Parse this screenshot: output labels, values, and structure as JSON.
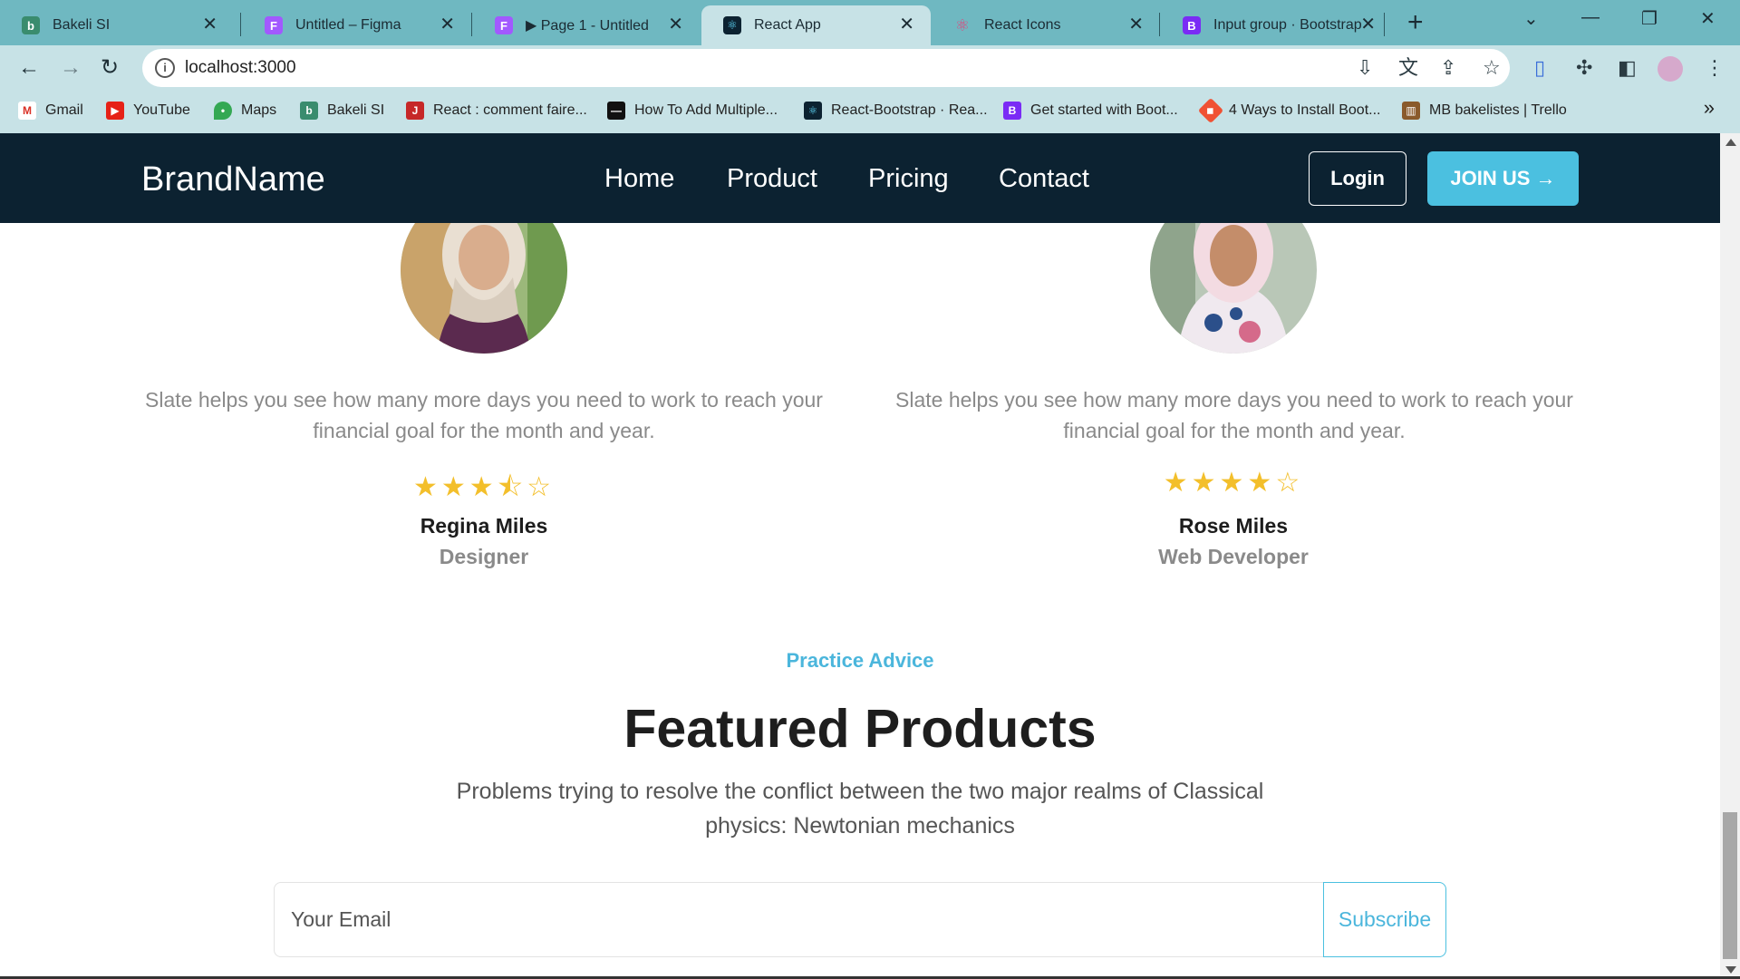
{
  "browser": {
    "tabs": [
      {
        "label": "Bakeli SI",
        "icon": "bakeli-icon",
        "color": "#3a8c6e"
      },
      {
        "label": "Untitled – Figma",
        "icon": "figma-icon",
        "color": "#a259ff"
      },
      {
        "label": "▶ Page 1 - Untitled",
        "icon": "figma-icon",
        "color": "#a259ff"
      },
      {
        "label": "React App",
        "icon": "react-icon",
        "color": "#0c2231"
      },
      {
        "label": "React Icons",
        "icon": "react-icon",
        "color": "#e0457b"
      },
      {
        "label": "Input group · Bootstrap",
        "icon": "bootstrap-icon",
        "color": "#7a2bf5"
      }
    ],
    "address": "localhost:3000",
    "bookmarks": [
      {
        "label": "Gmail",
        "icon": "gmail-icon"
      },
      {
        "label": "YouTube",
        "icon": "youtube-icon"
      },
      {
        "label": "Maps",
        "icon": "maps-icon"
      },
      {
        "label": "Bakeli SI",
        "icon": "bakeli-icon"
      },
      {
        "label": "React : comment faire...",
        "icon": "j-icon"
      },
      {
        "label": "How To Add Multiple...",
        "icon": "page-icon"
      },
      {
        "label": "React-Bootstrap · Rea...",
        "icon": "rb-icon"
      },
      {
        "label": "Get started with Boot...",
        "icon": "bootstrap-icon"
      },
      {
        "label": "4 Ways to Install Boot...",
        "icon": "git-icon"
      },
      {
        "label": "MB bakelistes | Trello",
        "icon": "trello-icon"
      }
    ]
  },
  "site": {
    "brand": "BrandName",
    "nav": [
      "Home",
      "Product",
      "Pricing",
      "Contact"
    ],
    "login": "Login",
    "join": "JOIN US →",
    "accent": "#4bc0e0",
    "navbar_bg": "#0c2231"
  },
  "testimonials": [
    {
      "quote": "Slate helps you see how many more days you need to work to reach your financial goal for the month and year.",
      "stars": "★★★⯪☆",
      "rating": 3.5,
      "name": "Regina Miles",
      "role": "Designer"
    },
    {
      "quote": "Slate helps you see how many more days you need to work to reach your financial goal for the month and year.",
      "stars": "★★★★☆",
      "rating": 4,
      "name": "Rose Miles",
      "role": "Web Developer"
    }
  ],
  "featured": {
    "kicker": "Practice Advice",
    "title": "Featured Products",
    "subtitle": "Problems trying to resolve the conflict between the two major realms of Classical physics: Newtonian mechanics"
  },
  "subscribe": {
    "placeholder": "Your Email",
    "button": "Subscribe"
  }
}
